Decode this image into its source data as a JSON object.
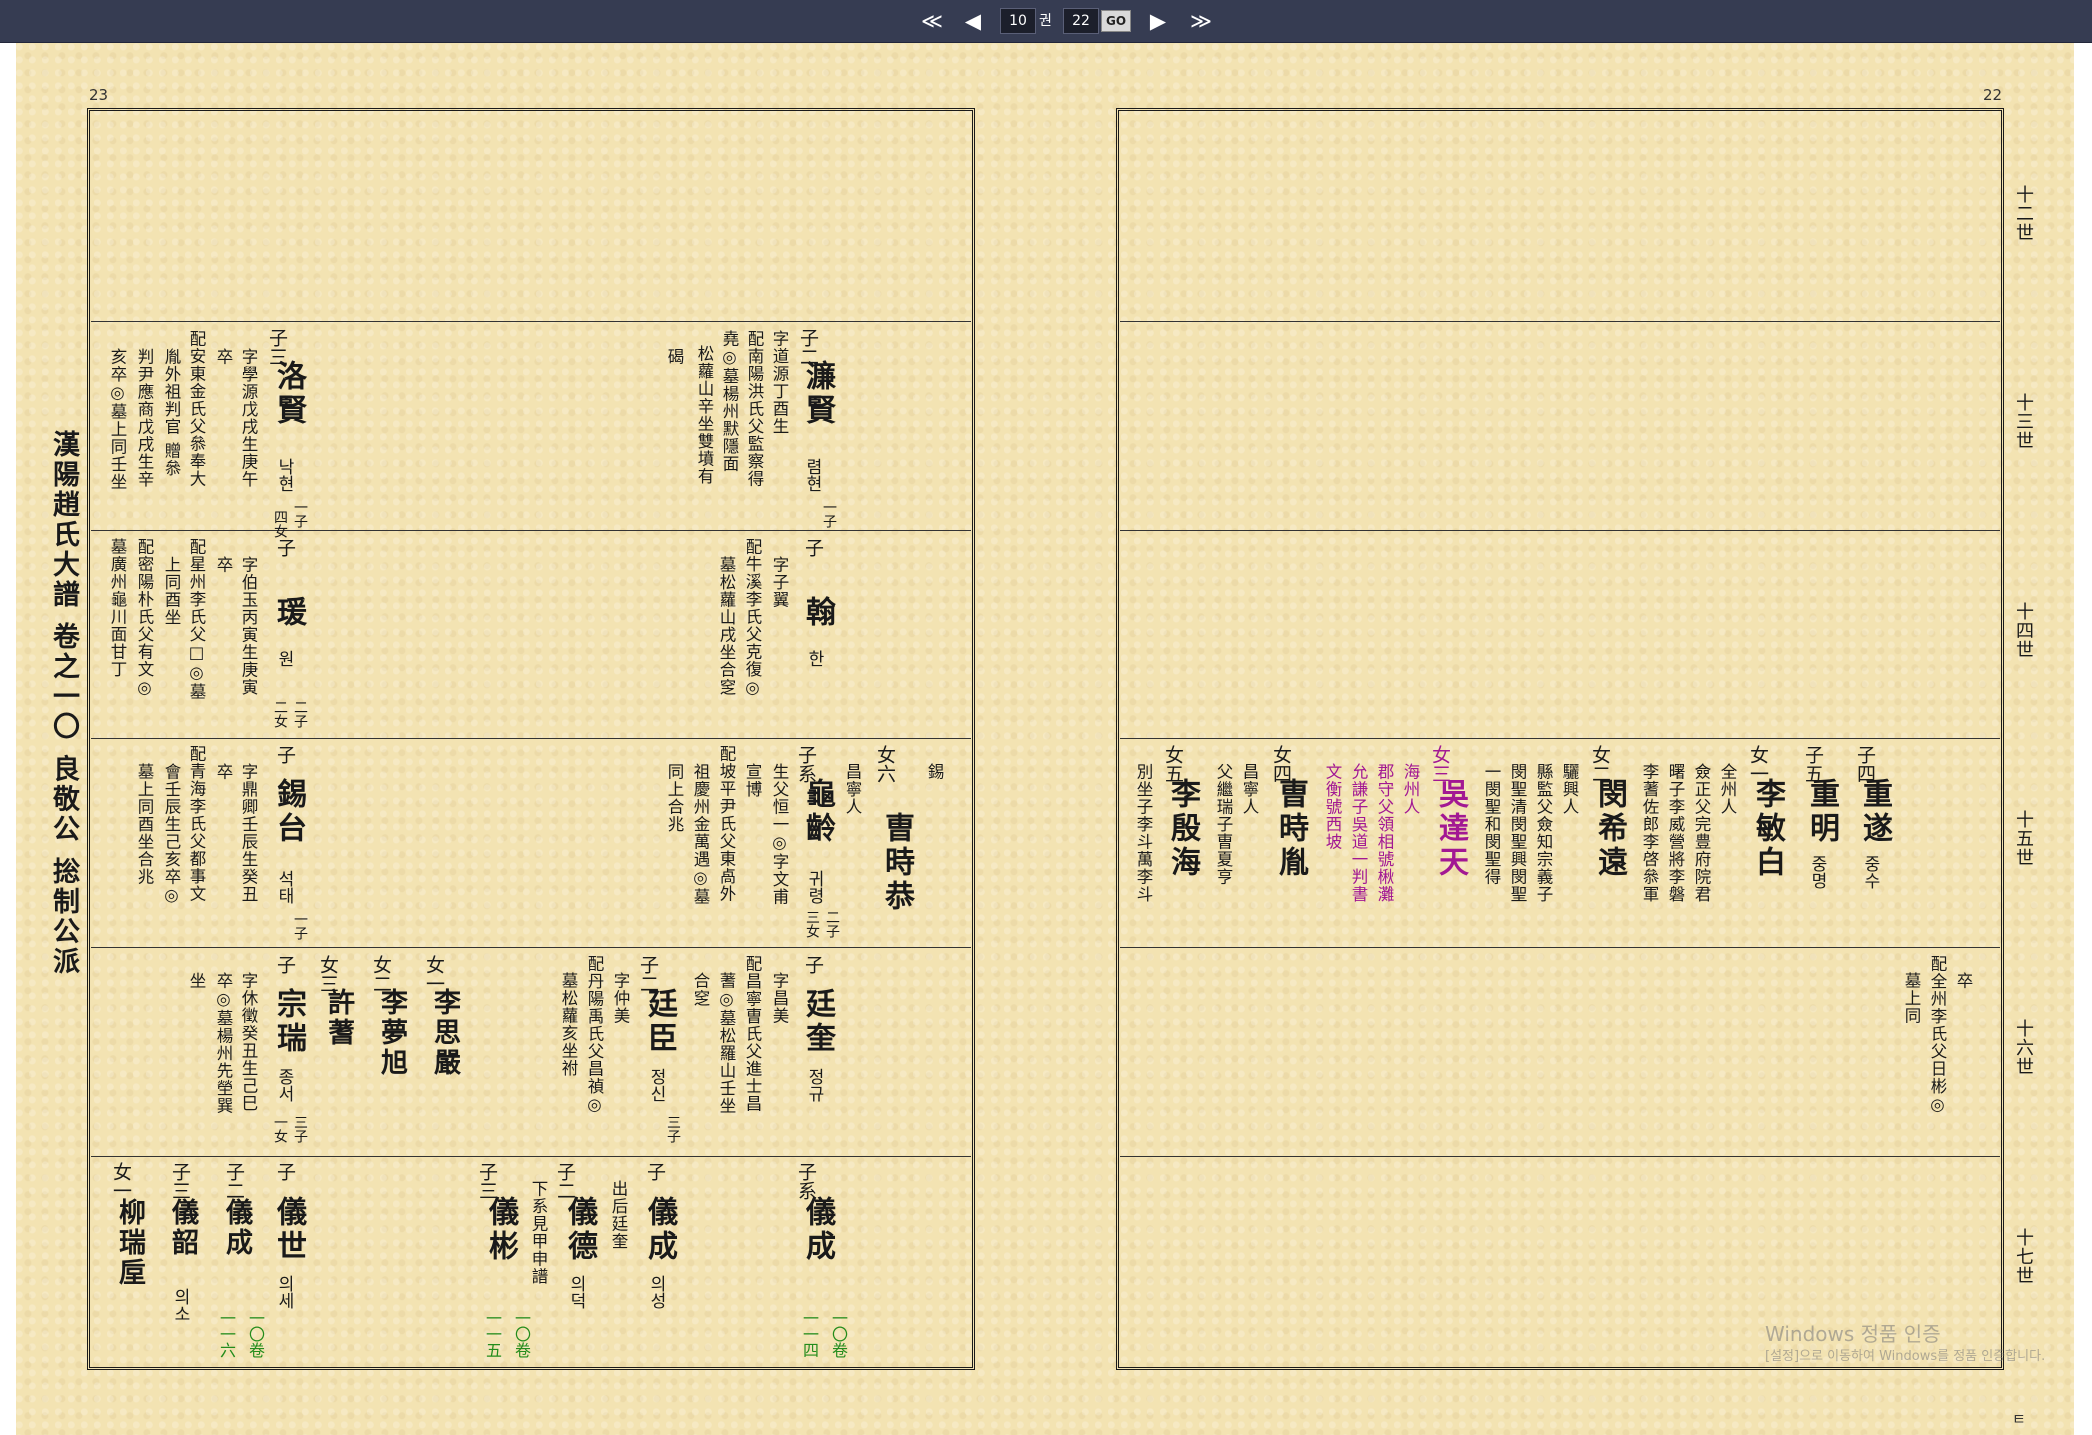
{
  "nav": {
    "first": "≪",
    "prev": "◀",
    "volume": "10",
    "volume_unit": "권",
    "page": "22",
    "go": "GO",
    "next": "▶",
    "last": "≫"
  },
  "left_page": {
    "page_number": "23",
    "spine_title": "漢陽趙氏大譜 卷之一〇 良敬公 捴制公派",
    "row2": {
      "c1": {
        "rel": "子二",
        "name": "濂賢",
        "kor": "렴현",
        "kids": "一子",
        "details": [
          "字道源丁酉生",
          "配南陽洪氏父監察得",
          "堯◎墓楊州默隱面",
          "松蘿山辛坐雙墳有",
          "碣"
        ]
      },
      "c2": {
        "rel": "子三",
        "name": "洛賢",
        "kor": "낙현",
        "kids": [
          "一子",
          "四女"
        ],
        "details": [
          "字學源戊戌生庚午",
          "卒",
          "配安東金氏父叅奉大",
          "胤外祖判官 贈叅",
          "判尹應商戊戌生辛",
          "亥卒◎墓上同壬坐"
        ]
      }
    },
    "row3": {
      "c1": {
        "rel": "子",
        "name": "翰",
        "kor": "한",
        "details": [
          "字子翼",
          "配牛溪李氏父克復◎",
          "墓松蘿山戌坐合窆"
        ]
      },
      "c2": {
        "rel": "子",
        "name": "瑗",
        "kor": "원",
        "kids": [
          "二子",
          "二女"
        ],
        "details": [
          "字伯玉丙寅生庚寅",
          "卒",
          "配星州李氏父□◎墓",
          "上同酉坐",
          "配密陽朴氏父有文◎",
          "墓廣州龜川面甘丁"
        ]
      }
    },
    "row4": {
      "c1a": {
        "rel": "女六",
        "name": "曺時恭",
        "small": "昌寧人",
        "edge": "錫"
      },
      "c1b": {
        "rel": "子系",
        "name": "龜齡",
        "kor": "귀령",
        "kids": [
          "二子",
          "三女"
        ],
        "details": [
          "生父恒一◎字文甫",
          "宣博",
          "配坡平尹氏父東卨外",
          "祖慶州金萬遇◎墓",
          "同上合兆"
        ]
      },
      "c2": {
        "rel": "子",
        "name": "錫台",
        "kor": "석태",
        "kids": "一子",
        "details": [
          "字鼎卿壬辰生癸丑",
          "卒",
          "配青海李氏父都事文",
          "會壬辰生己亥卒◎",
          "墓上同酉坐合兆"
        ]
      }
    },
    "row5": {
      "c1a": {
        "rel": "子",
        "name": "廷奎",
        "kor": "정규",
        "details": [
          "字昌美",
          "配昌寧曺氏父進士昌",
          "蓍◎墓松羅山壬坐",
          "合窆"
        ]
      },
      "c1b": {
        "rel": "子二",
        "name": "廷臣",
        "kor": "정신",
        "kids": "三子",
        "details": [
          "字仲美",
          "配丹陽禹氏父昌禎◎",
          "墓松蘿亥坐祔"
        ]
      },
      "daughters": [
        {
          "rel": "女一",
          "name": "李思嚴"
        },
        {
          "rel": "女二",
          "name": "李夢旭"
        },
        {
          "rel": "女三",
          "name": "許蓍"
        }
      ],
      "c2": {
        "rel": "子",
        "name": "宗瑞",
        "kor": "종서",
        "kids": [
          "三子",
          "一女"
        ],
        "details": [
          "字休徵癸丑生己巳",
          "卒◎墓楊州先塋巽",
          "坐"
        ]
      }
    },
    "row6": {
      "a": {
        "rel": "子系",
        "name": "儀成",
        "ref": [
          "一〇卷",
          "一一四"
        ]
      },
      "b": {
        "rel": "子",
        "name": "儀成",
        "kor": "의성",
        "note": "出后廷奎"
      },
      "c": {
        "rel": "子二",
        "name": "儀德",
        "kor": "의덕",
        "note": "下系見甲申譜"
      },
      "d": {
        "rel": "子三",
        "name": "儀彬",
        "ref": [
          "一〇卷",
          "一一五"
        ]
      },
      "e": {
        "rel": "子",
        "name": "儀世",
        "kor": "의세",
        "ref": [
          "一〇卷",
          "一一六"
        ]
      },
      "f": {
        "rel": "子二",
        "name": "儀成"
      },
      "g": {
        "rel": "子三",
        "name": "儀韶",
        "kor": "의소"
      },
      "h": {
        "rel": "女一",
        "name": "柳瑞垕"
      }
    }
  },
  "right_page": {
    "page_number": "22",
    "generations": [
      "十二世",
      "十三世",
      "十四世",
      "十五世",
      "十六世",
      "十七世"
    ],
    "row4": {
      "p1": {
        "rel": "子四",
        "name": "重遂",
        "kor": "중수"
      },
      "p2": {
        "rel": "子五",
        "name": "重明",
        "kor": "중명"
      },
      "p3": {
        "rel": "女一",
        "name": "李敏白",
        "details": [
          "全州人",
          "僉正父完豊府院君",
          "曙子李威營將李磐",
          "李蓍佐郎李啓叅軍"
        ]
      },
      "p4": {
        "rel": "女二",
        "name": "閔希遠",
        "details": [
          "驪興人",
          "縣監父僉知宗義子",
          "閔聖清閔聖興閔聖",
          "一閔聖和閔聖得"
        ]
      },
      "p5": {
        "rel": "女三",
        "name": "吳達天",
        "details": [
          "海州人",
          "郡守父領相號楸灘",
          "允謙子吳道一判書",
          "文衡號西坡"
        ]
      },
      "p6": {
        "rel": "女四",
        "name": "曺時胤",
        "details": [
          "昌寧人",
          "父繼瑞子曺夏亨"
        ]
      },
      "p7": {
        "rel": "女五",
        "name": "李殷海",
        "details": [
          "別坐子李斗萬李斗"
        ]
      }
    },
    "row5": {
      "details": [
        "卒",
        "配全州李氏父日彬◎",
        "墓上同"
      ]
    }
  },
  "watermark": {
    "line1": "Windows 정품 인증",
    "line2": "[설정]으로 이동하여 Windows를 정품 인증합니다."
  },
  "footer_glyph": "ㅌ"
}
